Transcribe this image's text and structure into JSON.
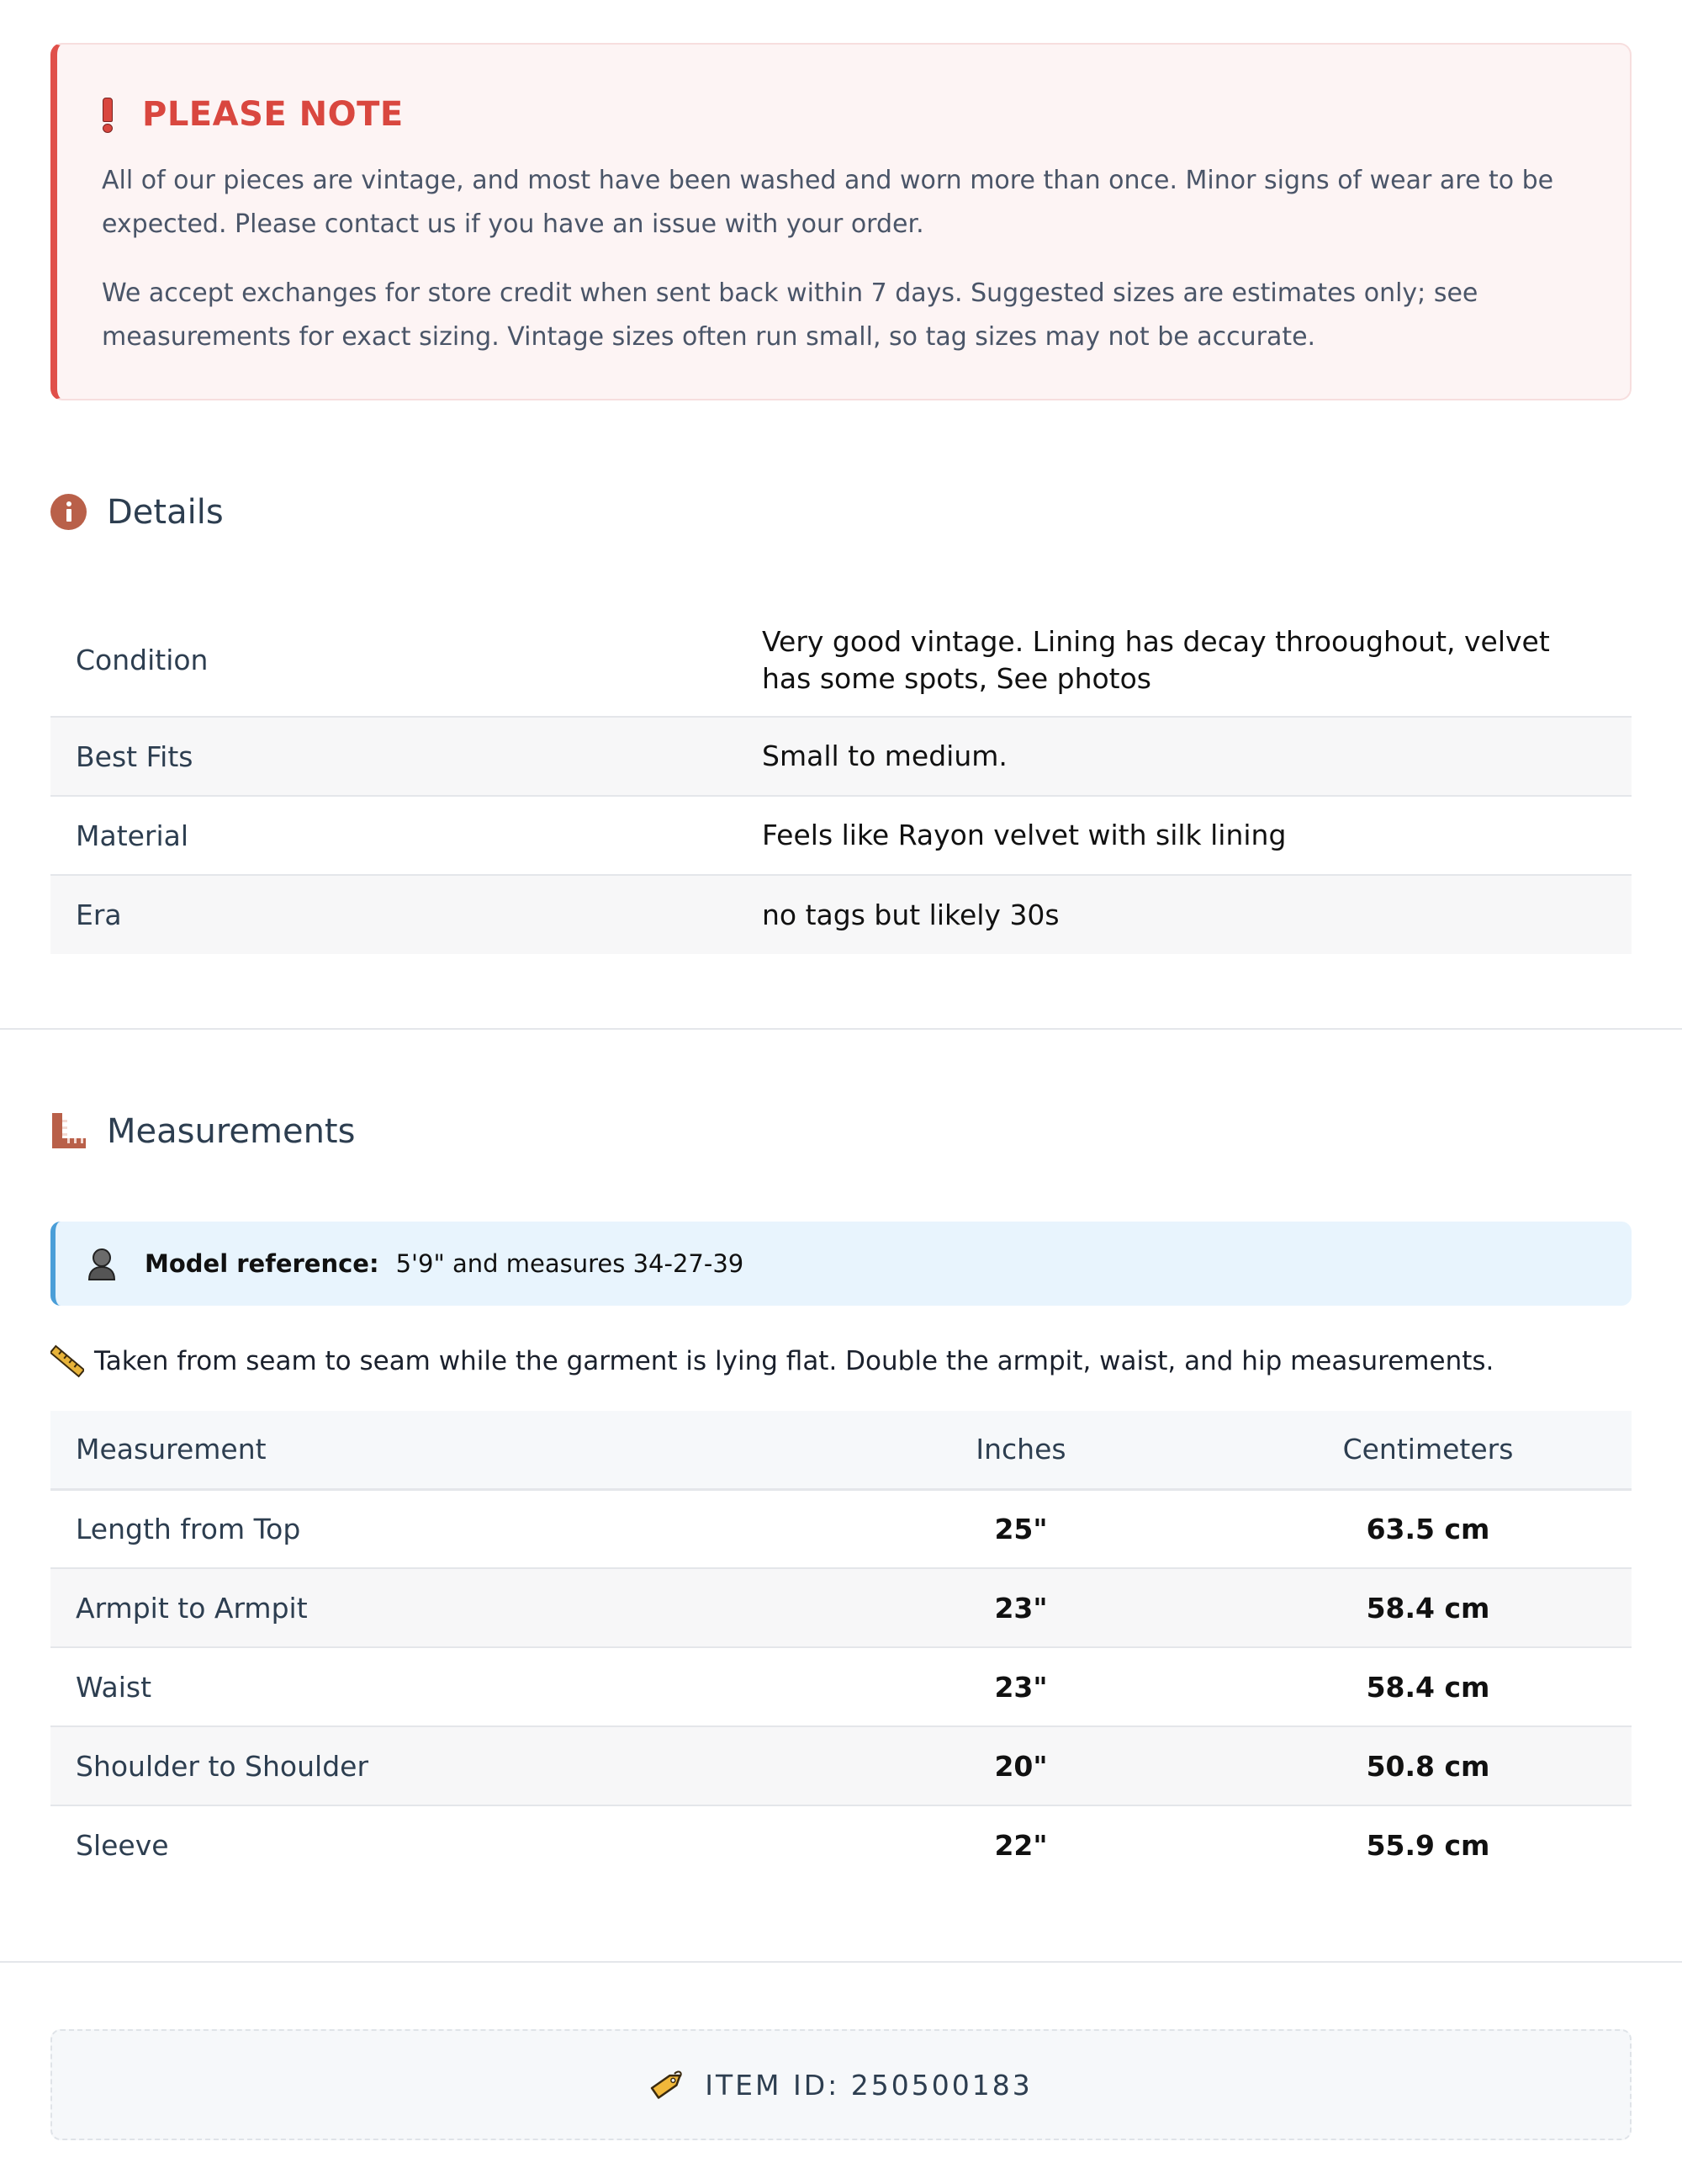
{
  "note": {
    "title": "PLEASE NOTE",
    "paragraph1": "All of our pieces are vintage, and most have been washed and worn more than once. Minor signs of wear are to be expected. Please contact us if you have an issue with your order.",
    "paragraph2": "We accept exchanges for store credit when sent back within 7 days. Suggested sizes are estimates only; see measurements for exact sizing. Vintage sizes often run small, so tag sizes may not be accurate."
  },
  "details": {
    "heading": "Details",
    "icon": "info-icon",
    "rows": [
      {
        "label": "Condition",
        "value": "Very good vintage. Lining has decay throoughout, velvet has some spots, See photos"
      },
      {
        "label": "Best Fits",
        "value": "Small to medium."
      },
      {
        "label": "Material",
        "value": "Feels like Rayon velvet with silk lining"
      },
      {
        "label": "Era",
        "value": "no tags but likely 30s"
      }
    ]
  },
  "measurements": {
    "heading": "Measurements",
    "icon": "ruler-icon",
    "model_label": "Model reference:",
    "model_value": "5'9\" and measures 34-27-39",
    "tip": "Taken from seam to seam while the garment is lying flat. Double the armpit, waist, and hip measurements.",
    "columns": [
      "Measurement",
      "Inches",
      "Centimeters"
    ],
    "rows": [
      {
        "name": "Length from Top",
        "inches": "25\"",
        "cm": "63.5 cm"
      },
      {
        "name": "Armpit to Armpit",
        "inches": "23\"",
        "cm": "58.4 cm"
      },
      {
        "name": "Waist",
        "inches": "23\"",
        "cm": "58.4 cm"
      },
      {
        "name": "Shoulder to Shoulder",
        "inches": "20\"",
        "cm": "50.8 cm"
      },
      {
        "name": "Sleeve",
        "inches": "22\"",
        "cm": "55.9 cm"
      }
    ]
  },
  "item": {
    "label": "ITEM ID: 250500183"
  },
  "colors": {
    "note_accent": "#e0504a",
    "heading_icon": "#b96049",
    "model_accent": "#4a9ed8"
  }
}
